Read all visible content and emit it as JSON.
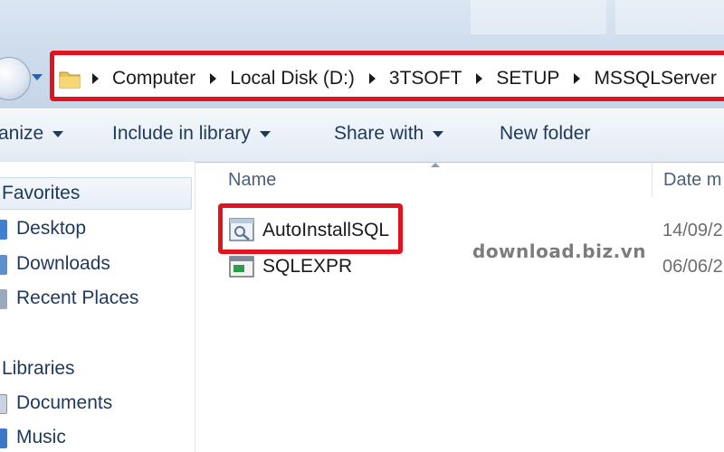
{
  "address_bar": {
    "breadcrumbs": [
      "Computer",
      "Local Disk (D:)",
      "3TSOFT",
      "SETUP",
      "MSSQLServer"
    ]
  },
  "toolbar": {
    "organize_label": "anize",
    "include_label": "Include in library",
    "share_label": "Share with",
    "new_folder_label": "New folder"
  },
  "nav": {
    "favorites_header": "Favorites",
    "favorites": [
      "Desktop",
      "Downloads",
      "Recent Places"
    ],
    "libraries_header": "Libraries",
    "libraries": [
      "Documents",
      "Music"
    ]
  },
  "columns": {
    "name": "Name",
    "date_modified": "Date m"
  },
  "files": [
    {
      "name": "AutoInstallSQL",
      "date": "14/09/2",
      "icon": "script-file-icon"
    },
    {
      "name": "SQLEXPR",
      "date": "06/06/2",
      "icon": "installer-exe-icon"
    }
  ],
  "watermark": "download.biz.vn",
  "colors": {
    "highlight_red": "#e0131f",
    "toolbar_text": "#1e395b",
    "chrome_blue": "#cfdcec"
  }
}
